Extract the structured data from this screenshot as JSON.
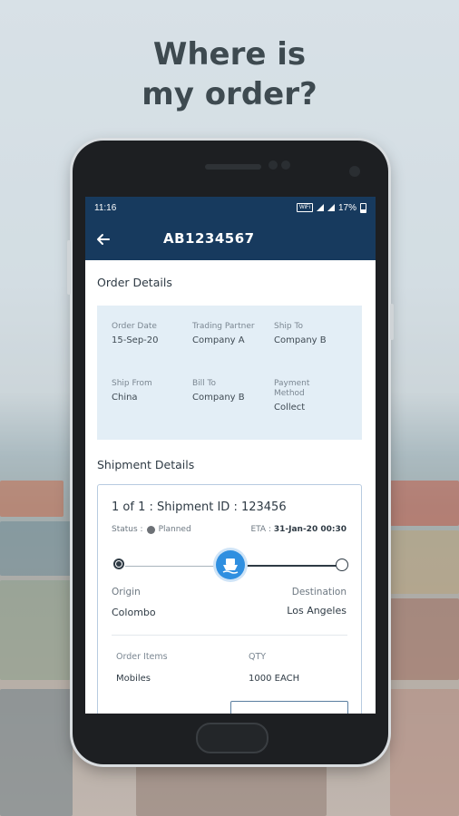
{
  "headline": {
    "line1": "Where is",
    "line2": "my order?"
  },
  "status_bar": {
    "time": "11:16",
    "wifi": "WiFi",
    "battery": "17%"
  },
  "app_bar": {
    "title": "AB1234567"
  },
  "order_details": {
    "title": "Order Details",
    "fields": [
      {
        "label": "Order Date",
        "value": "15-Sep-20"
      },
      {
        "label": "Trading Partner",
        "value": "Company A"
      },
      {
        "label": "Ship To",
        "value": "Company B"
      },
      {
        "label": "Ship From",
        "value": "China"
      },
      {
        "label": "Bill To",
        "value": "Company B"
      },
      {
        "label": "Payment Method",
        "value": "Collect"
      }
    ]
  },
  "shipment": {
    "title": "Shipment Details",
    "header": "1 of 1 : Shipment ID : ",
    "shipment_id": "123456",
    "status_label": "Status :",
    "status_value": "Planned",
    "eta_label": "ETA :",
    "eta_value": "31-Jan-20 00:30",
    "origin_label": "Origin",
    "origin_value": "Colombo",
    "destination_label": "Destination",
    "destination_value": "Los Angeles",
    "items_label": "Order Items",
    "items_value": "Mobiles",
    "qty_label": "QTY",
    "qty_value": "1000 EACH"
  },
  "colors": {
    "nav_blue": "#173a5e",
    "panel_blue": "#e3eef6",
    "accent_blue": "#2f8fe0"
  },
  "icons": [
    "back-arrow-icon",
    "ship-icon"
  ]
}
